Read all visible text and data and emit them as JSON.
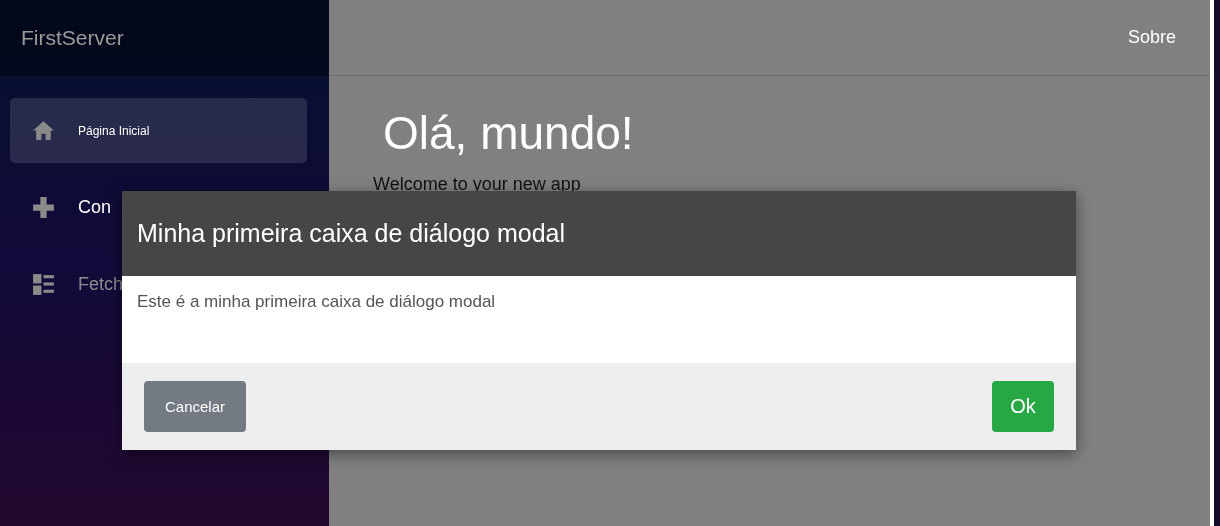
{
  "sidebar": {
    "brand": "FirstServer",
    "items": [
      {
        "kind": "home",
        "label": "Página Inicial",
        "selected": true,
        "hovered": false
      },
      {
        "kind": "plus",
        "label": "Con",
        "selected": false,
        "hovered": true
      },
      {
        "kind": "list",
        "label": "Fetch",
        "selected": false,
        "hovered": false
      }
    ]
  },
  "top_bar": {
    "link": "Sobre"
  },
  "content": {
    "heading": "Olá, mundo!",
    "text": "Welcome to your new app"
  },
  "modal": {
    "title": "Minha primeira caixa de diálogo modal",
    "body": "Este é a minha primeira caixa de diálogo modal",
    "buttons": [
      {
        "kind": "secondary",
        "label": "Cancelar"
      },
      {
        "kind": "primary",
        "label": "Ok"
      }
    ]
  }
}
